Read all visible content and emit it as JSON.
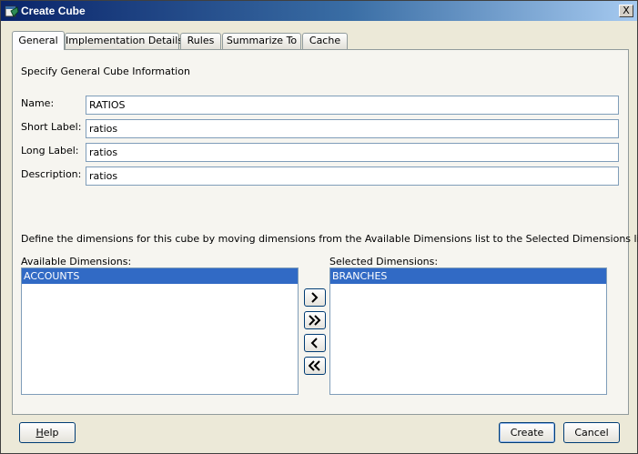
{
  "window": {
    "title": "Create Cube",
    "close_label": "X"
  },
  "tabs": [
    {
      "label": "General",
      "active": true
    },
    {
      "label": "Implementation Details",
      "active": false
    },
    {
      "label": "Rules",
      "active": false
    },
    {
      "label": "Summarize To",
      "active": false
    },
    {
      "label": "Cache",
      "active": false
    }
  ],
  "general": {
    "section_title": "Specify General Cube Information",
    "name_label": "Name:",
    "name_value": "RATIOS",
    "short_label_label": "Short Label:",
    "short_label_value": "ratios",
    "long_label_label": "Long Label:",
    "long_label_value": "ratios",
    "description_label": "Description:",
    "description_value": "ratios"
  },
  "dimensions": {
    "instruction": "Define the dimensions for this cube by moving dimensions from the Available Dimensions list to the Selected Dimensions list",
    "available_label": "Available Dimensions:",
    "available_items": [
      "ACCOUNTS"
    ],
    "selected_label": "Selected Dimensions:",
    "selected_items": [
      "BRANCHES"
    ]
  },
  "shuttle_icons": [
    "move-right-icon",
    "move-all-right-icon",
    "move-left-icon",
    "move-all-left-icon"
  ],
  "footer": {
    "help_first": "H",
    "help_rest": "elp",
    "create_label": "Create",
    "cancel_label": "Cancel"
  }
}
